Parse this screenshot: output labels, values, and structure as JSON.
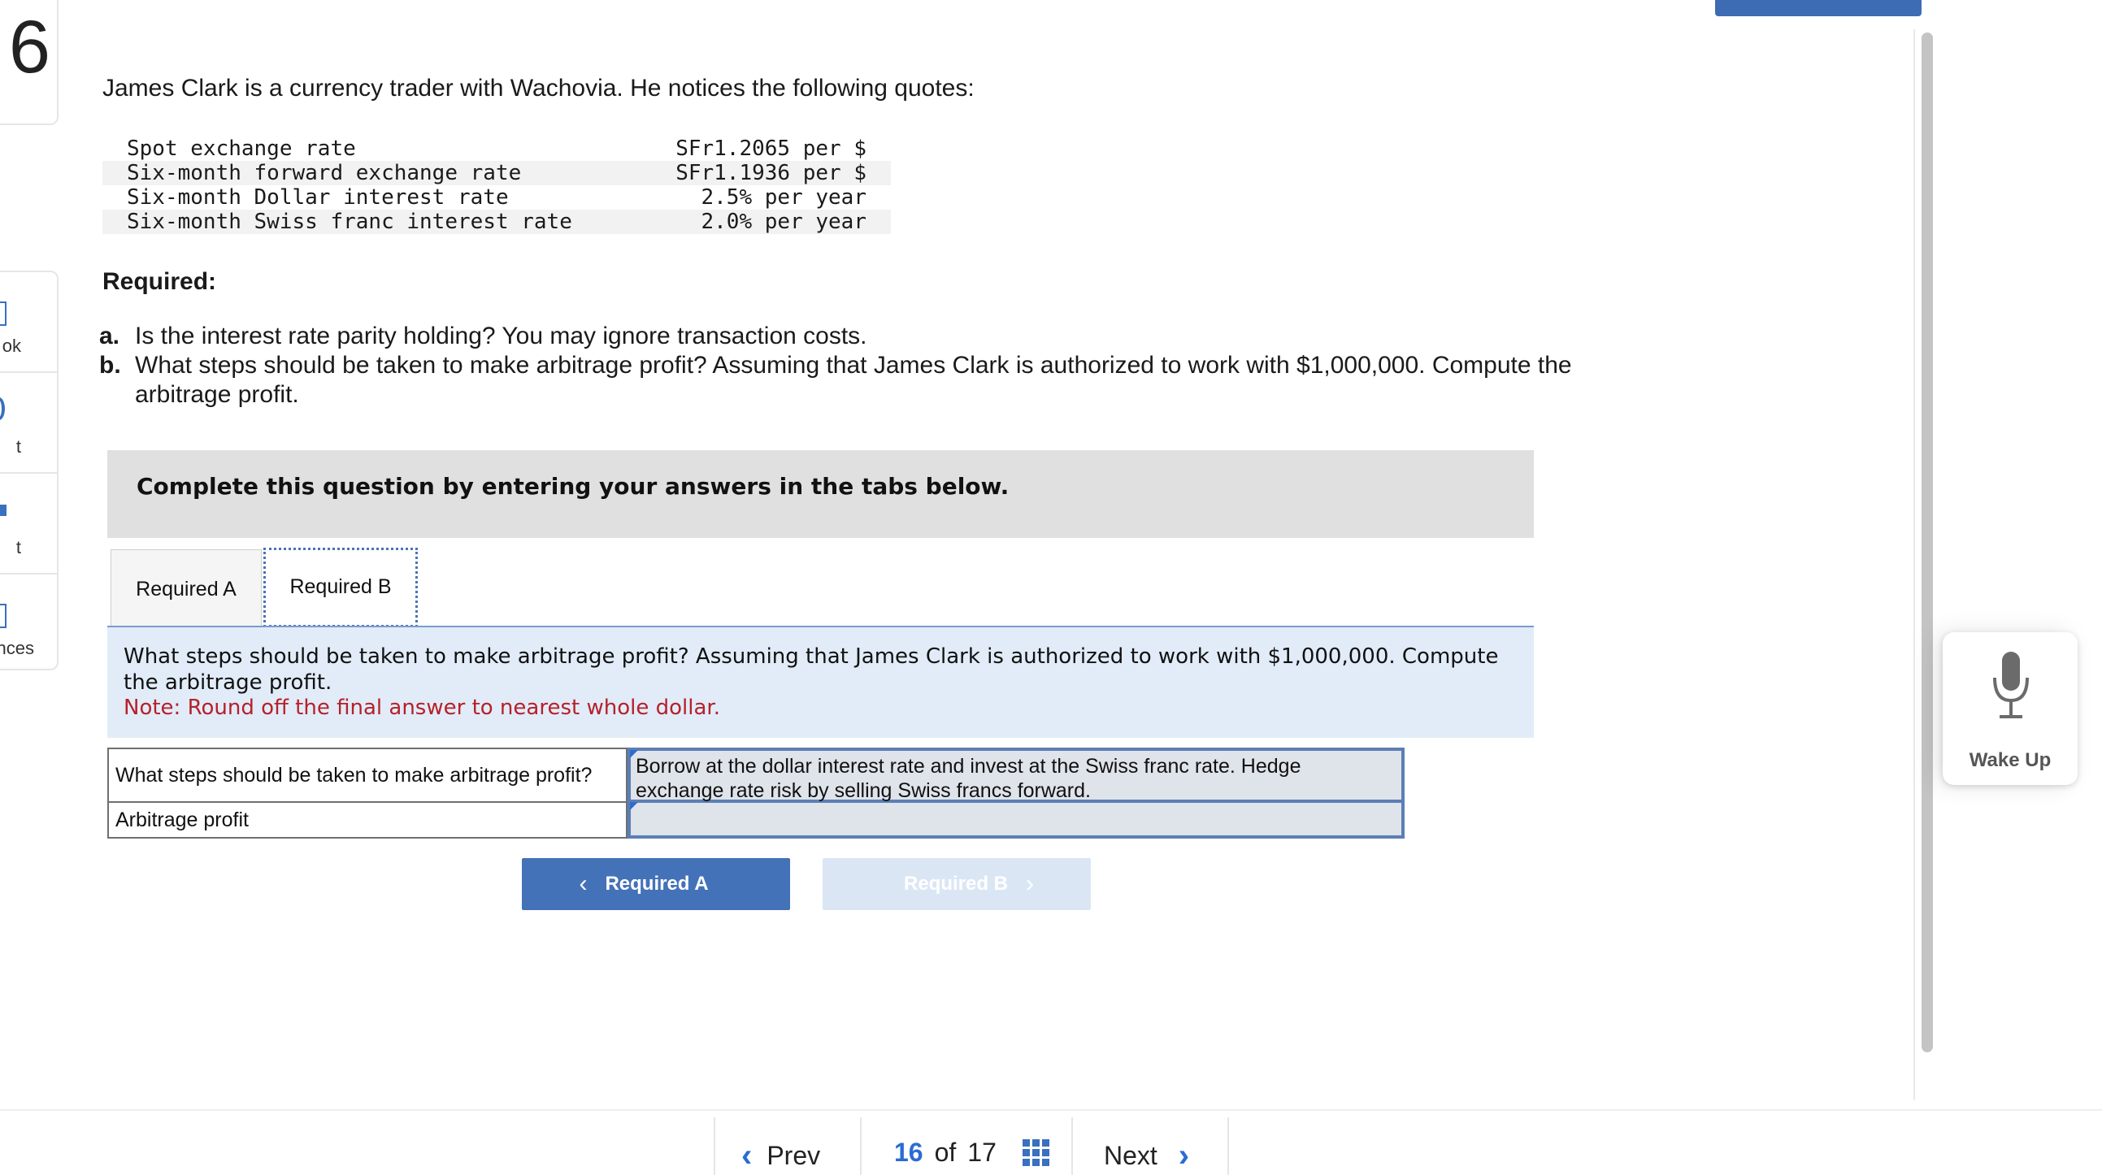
{
  "sidebar": {
    "question_number": "6",
    "items": [
      {
        "label": "ok",
        "icon": "book-icon"
      },
      {
        "label": "t",
        "icon": "hint-icon"
      },
      {
        "label": "t",
        "icon": "print-icon"
      },
      {
        "label": "nces",
        "icon": "references-icon"
      }
    ]
  },
  "problem": {
    "intro": "James Clark is a currency trader with Wachovia. He notices the following quotes:",
    "quotes": [
      {
        "label": "Spot exchange rate",
        "value": "SFr1.2065 per $"
      },
      {
        "label": "Six-month forward exchange rate",
        "value": "SFr1.1936 per $"
      },
      {
        "label": "Six-month Dollar interest rate",
        "value": "2.5% per year"
      },
      {
        "label": "Six-month Swiss franc interest rate",
        "value": "2.0% per year"
      }
    ],
    "required_heading": "Required:",
    "required_items": [
      {
        "letter": "a.",
        "text": "Is the interest rate parity holding? You may ignore transaction costs."
      },
      {
        "letter": "b.",
        "text": "What steps should be taken to make arbitrage profit? Assuming that James Clark is authorized to work with $1,000,000. Compute the arbitrage profit."
      }
    ]
  },
  "instruction": "Complete this question by entering your answers in the tabs below.",
  "tabs": [
    {
      "label": "Required A",
      "active": false
    },
    {
      "label": "Required B",
      "active": true
    }
  ],
  "question": {
    "text": "What steps should be taken to make arbitrage profit? Assuming that James Clark is authorized to work with $1,000,000. Compute the arbitrage profit.",
    "note": "Note: Round off the final answer to nearest whole dollar."
  },
  "answer_table": {
    "rows": [
      {
        "label": "What steps should be taken to make arbitrage profit?",
        "value": "Borrow at the dollar interest rate and invest at the Swiss franc rate. Hedge exchange rate risk by selling Swiss francs forward."
      },
      {
        "label": "Arbitrage profit",
        "value": ""
      }
    ]
  },
  "tab_nav": {
    "prev_label": "Required A",
    "next_label": "Required B"
  },
  "widget": {
    "label": "Wake Up"
  },
  "bottom_nav": {
    "prev_label": "Prev",
    "current_page": "16",
    "of_text": "of",
    "total_pages": "17",
    "next_label": "Next"
  },
  "colors": {
    "accent": "#4472b8",
    "note": "#b5212a",
    "instruction_bg": "#e0e0e0",
    "question_bg": "#e1ecf8"
  }
}
